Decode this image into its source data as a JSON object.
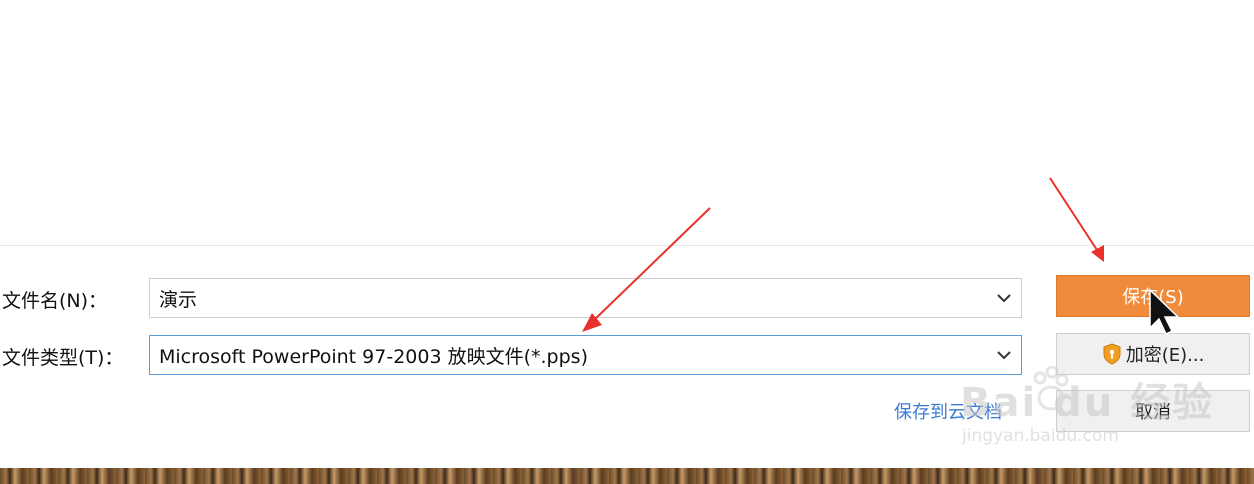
{
  "form": {
    "filename_label": "文件名(N)：",
    "filename_value": "演示",
    "filetype_label": "文件类型(T)：",
    "filetype_value": "Microsoft PowerPoint 97-2003 放映文件(*.pps)"
  },
  "buttons": {
    "save": "保存(S)",
    "encrypt": "加密(E)...",
    "cancel": "取消"
  },
  "links": {
    "save_to": "保存到云文档"
  },
  "watermark": {
    "brand": "Bai du 经验",
    "url": "jingyan.baidu.com"
  },
  "colors": {
    "primary_button": "#f08b3c",
    "annotation_arrow": "#e8312b",
    "link": "#3a7bd5"
  }
}
